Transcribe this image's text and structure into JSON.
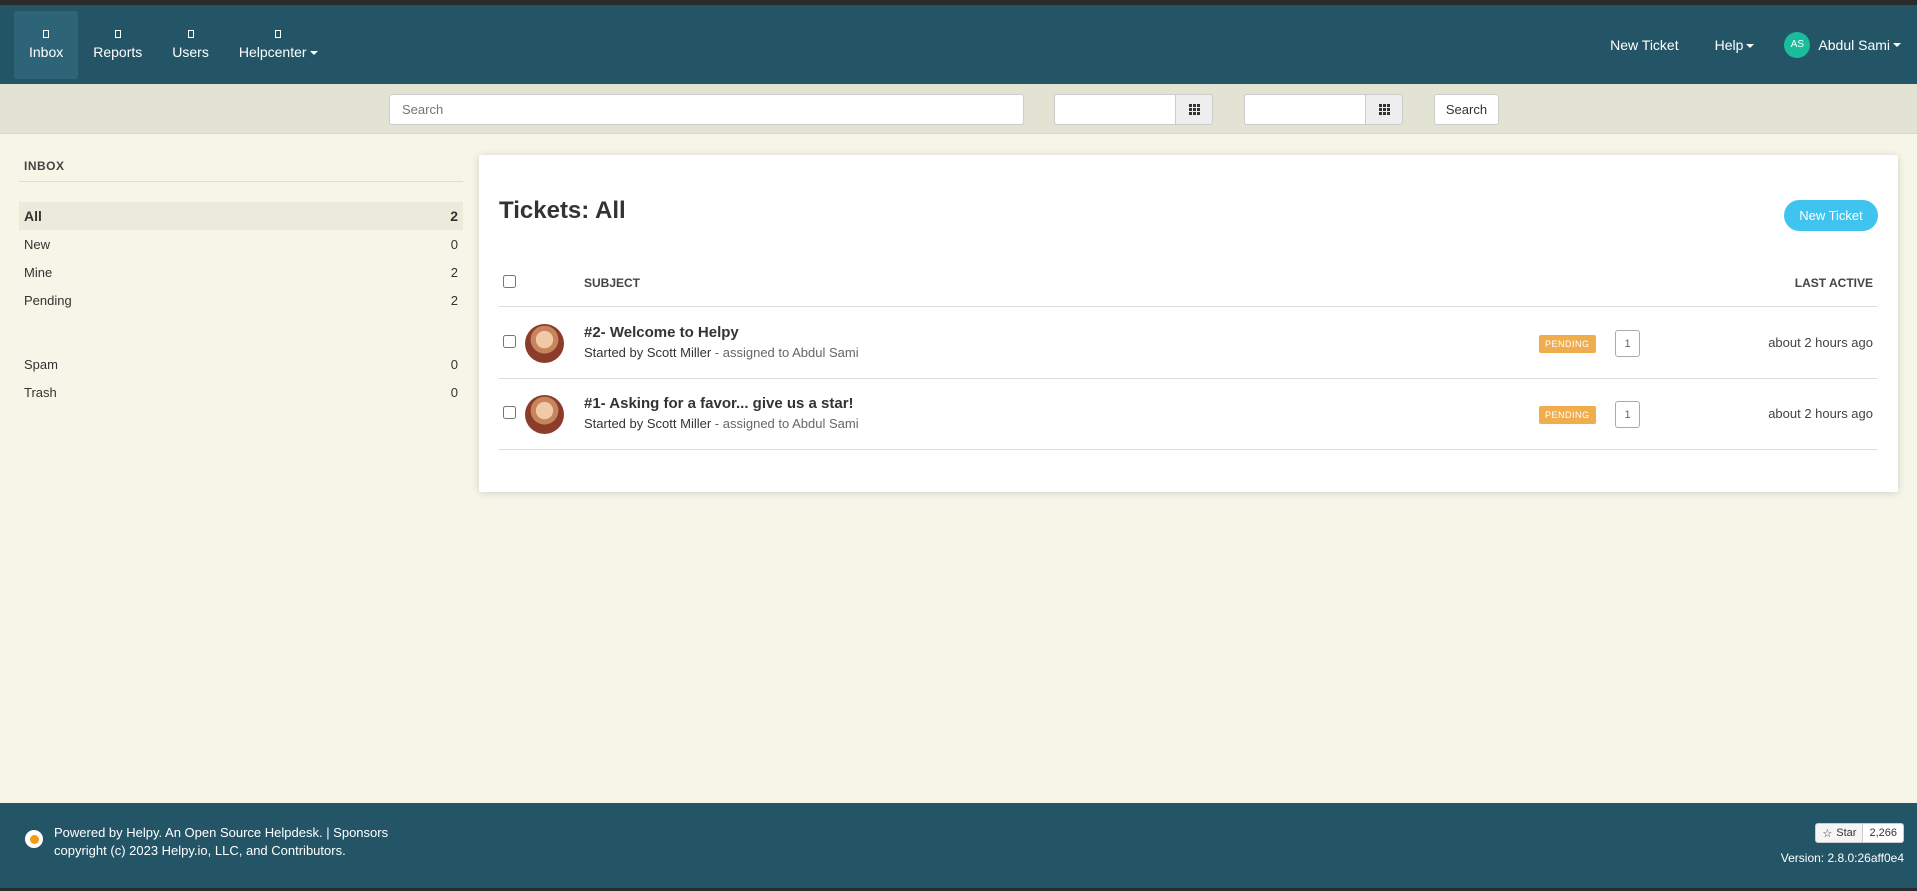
{
  "nav": {
    "items": [
      {
        "label": "Inbox",
        "active": true
      },
      {
        "label": "Reports"
      },
      {
        "label": "Users"
      },
      {
        "label": "Helpcenter"
      }
    ],
    "new_ticket": "New Ticket",
    "help": "Help",
    "user_initials": "AS",
    "user_name": "Abdul Sami"
  },
  "search": {
    "placeholder": "Search",
    "button": "Search"
  },
  "sidebar": {
    "title": "INBOX",
    "items": [
      {
        "label": "All",
        "count": "2"
      },
      {
        "label": "New",
        "count": "0"
      },
      {
        "label": "Mine",
        "count": "2"
      },
      {
        "label": "Pending",
        "count": "2"
      },
      {
        "label": "Spam",
        "count": "0"
      },
      {
        "label": "Trash",
        "count": "0"
      }
    ]
  },
  "main": {
    "title": "Tickets: All",
    "new_ticket_button": "New Ticket",
    "columns": {
      "subject": "SUBJECT",
      "last_active": "LAST ACTIVE"
    },
    "tickets": [
      {
        "subject": "#2- Welcome to Helpy",
        "started_by_prefix": "Started by",
        "started_by": "Scott Miller",
        "assigned_prefix": " - assigned to",
        "assigned_to": "Abdul Sami",
        "status": "PENDING",
        "count": "1",
        "last_active": "about 2 hours ago"
      },
      {
        "subject": "#1- Asking for a favor... give us a star!",
        "started_by_prefix": "Started by",
        "started_by": "Scott Miller",
        "assigned_prefix": " - assigned to",
        "assigned_to": "Abdul Sami",
        "status": "PENDING",
        "count": "1",
        "last_active": "about 2 hours ago"
      }
    ]
  },
  "footer": {
    "line1": "Powered by Helpy. An Open Source Helpdesk. | Sponsors",
    "line2": "copyright (c) 2023 Helpy.io, LLC, and Contributors.",
    "star_label": "Star",
    "star_count": "2,266",
    "version": "Version: 2.8.0:26aff0e4"
  },
  "colors": {
    "navbar": "#235567",
    "accent": "#3fc4ef",
    "pending": "#f0ad4e",
    "background": "#f5f5e8"
  }
}
